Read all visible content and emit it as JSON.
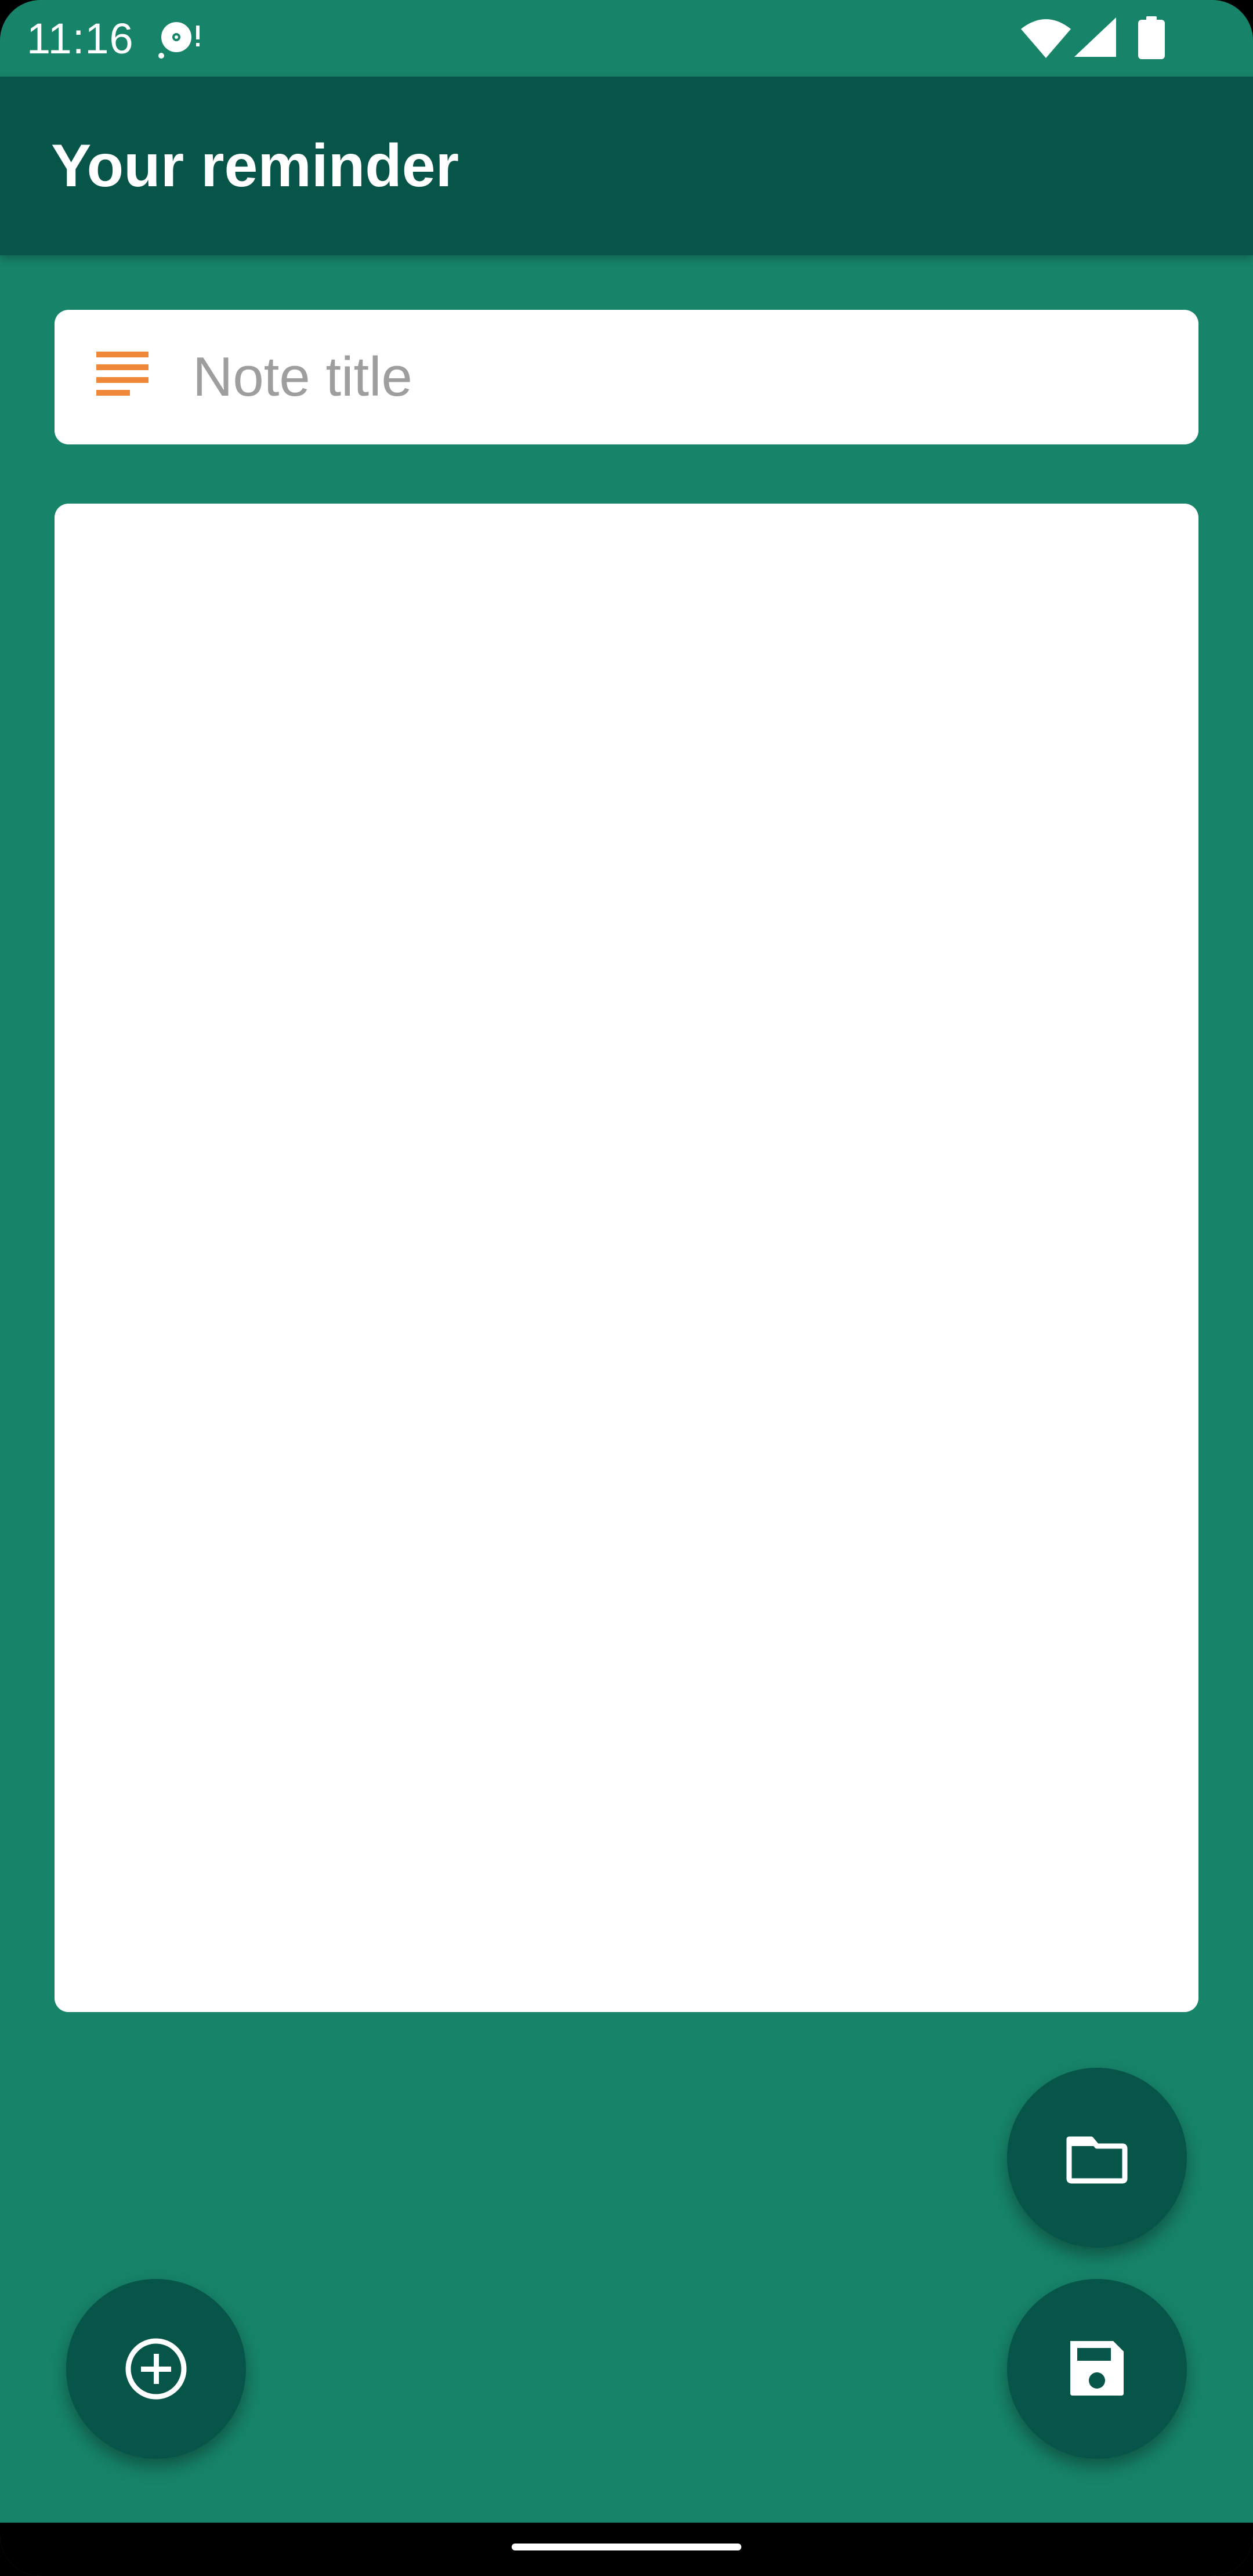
{
  "status_bar": {
    "time": "11:16",
    "icons": [
      "disc-icon",
      "wifi-icon",
      "signal-icon",
      "battery-icon"
    ]
  },
  "app_bar": {
    "title": "Your reminder"
  },
  "note": {
    "title_placeholder": "Note title",
    "title_value": "",
    "body_value": ""
  },
  "fabs": {
    "open_icon": "folder-icon",
    "save_icon": "save-icon",
    "add_icon": "add-circle-icon"
  },
  "colors": {
    "background": "#17846a",
    "app_bar": "#065548",
    "fab": "#065548",
    "title_icon": "#f0883a",
    "field": "#ffffff"
  }
}
